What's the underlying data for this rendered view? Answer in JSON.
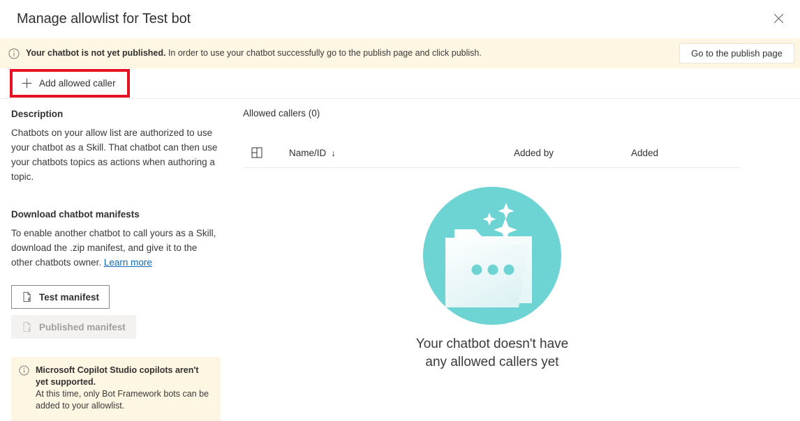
{
  "header": {
    "title": "Manage allowlist for Test bot",
    "close_icon": "close-icon"
  },
  "publish_banner": {
    "info_icon": "info-circle-icon",
    "bold_text": "Your chatbot is not yet published.",
    "rest_text": " In order to use your chatbot successfully go to the publish page and click publish.",
    "button_label": "Go to the publish page"
  },
  "command_bar": {
    "add_caller_label": "Add allowed caller",
    "plus_icon": "plus-icon",
    "highlight_color": "#e81123"
  },
  "left_pane": {
    "description_heading": "Description",
    "description_text": "Chatbots on your allow list are authorized to use your chatbot as a Skill. That chatbot can then use your chatbots topics as actions when authoring a topic.",
    "download_heading": "Download chatbot manifests",
    "download_text": "To enable another chatbot to call yours as a Skill, download the .zip manifest, and give it to the other chatbots owner. ",
    "learn_more_label": "Learn more",
    "test_manifest_label": "Test manifest",
    "published_manifest_label": "Published manifest",
    "manifest_icon": "document-download-icon",
    "support_note": {
      "info_icon": "info-circle-icon",
      "title": "Microsoft Copilot Studio copilots aren't yet supported.",
      "body": "At this time, only Bot Framework bots can be added to your allowlist."
    }
  },
  "right_pane": {
    "list_title": "Allowed callers (0)",
    "table": {
      "row_icon": "table-grid-icon",
      "columns": [
        {
          "label": "Name/ID",
          "sort_icon": "↓"
        },
        {
          "label": "Added by",
          "sort_icon": ""
        },
        {
          "label": "Added",
          "sort_icon": ""
        }
      ],
      "rows": []
    },
    "empty_state": {
      "illustration": "empty-folder-illustration",
      "message": "Your chatbot doesn't have any allowed callers yet",
      "accent_color": "#6ed3d3"
    }
  }
}
